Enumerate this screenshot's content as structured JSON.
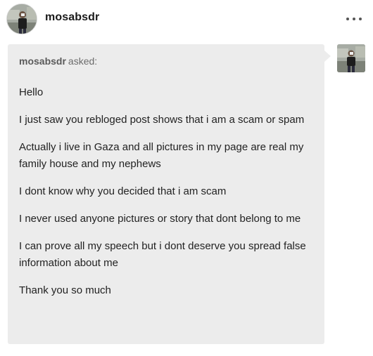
{
  "post": {
    "username": "mosabsdr",
    "more_icon": "ellipsis-icon"
  },
  "ask": {
    "asker_name": "mosabsdr",
    "asked_label": "asked:",
    "paragraphs": [
      "Hello",
      "I just saw you rebloged post shows that i am a scam or spam",
      "Actually i live in Gaza and all pictures in my page are real my family house and my nephews",
      "I dont know why you decided that i am scam",
      "I never used anyone pictures or story that dont belong to me",
      "I can prove all my speech but i dont deserve you spread false information about me",
      "Thank you so much"
    ]
  },
  "colors": {
    "bubble_bg": "#ececec",
    "text": "#222222",
    "muted": "#6b6b6b"
  }
}
